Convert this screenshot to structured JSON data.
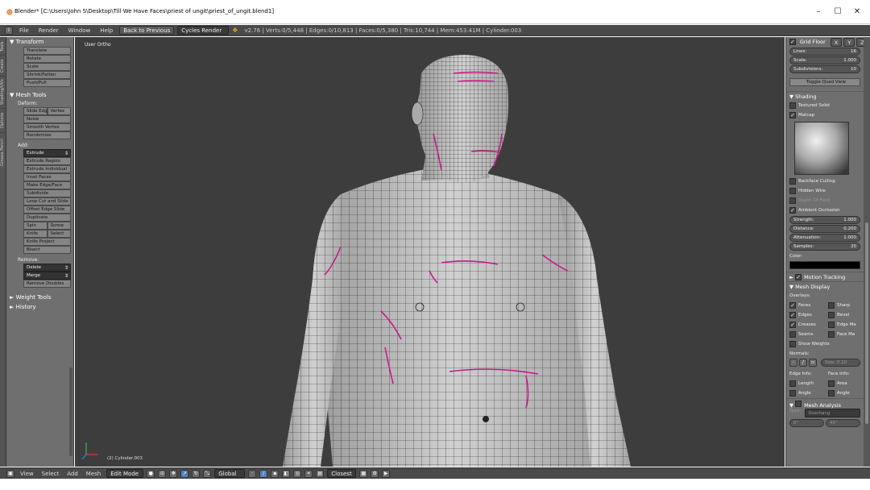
{
  "window": {
    "title": "Blender* [C:\\Users\\John S\\Desktop\\Till We Have Faces\\priest of ungit\\priest_of_ungit.blend1]",
    "minimize": "–",
    "maximize": "☐",
    "close": "✕"
  },
  "topbar": {
    "menus": [
      "File",
      "Render",
      "Window",
      "Help"
    ],
    "back_button": "Back to Previous",
    "render_engine": "Cycles Render",
    "stats": "v2.76 | Verts:0/5,448 | Edges:0/10,813 | Faces:0/5,380 | Tris:10,744 | Mem:453.41M | Cylinder.003"
  },
  "tabs": [
    "Tools",
    "Create",
    "Shading/UVs",
    "Options",
    "Grease Pencil"
  ],
  "toolshelf": {
    "transform_header": "Transform",
    "transform": [
      "Translate",
      "Rotate",
      "Scale",
      "Shrink/Fatten",
      "Push/Pull"
    ],
    "meshtools_header": "Mesh Tools",
    "deform_label": "Deform:",
    "deform_pair": [
      "Slide Edge",
      "Vertex"
    ],
    "deform": [
      "Noise",
      "Smooth Vertex",
      "Randomize"
    ],
    "add_label": "Add:",
    "extrude": "Extrude",
    "add": [
      "Extrude Region",
      "Extrude Individual",
      "Inset Faces",
      "Make Edge/Face",
      "Subdivide",
      "Loop Cut and Slide",
      "Offset Edge Slide",
      "Duplicate"
    ],
    "spin_pair": [
      "Spin",
      "Screw"
    ],
    "knife_pair": [
      "Knife",
      "Select"
    ],
    "add2": [
      "Knife Project",
      "Bisect"
    ],
    "remove_label": "Remove:",
    "delete": "Delete",
    "merge": "Merge",
    "remove_doubles": "Remove Doubles",
    "weight_tools": "Weight Tools",
    "history": "History"
  },
  "viewport": {
    "label": "User Ortho",
    "object_label": "(2) Cylinder.003"
  },
  "props": {
    "grid_floor": "Grid Floor",
    "axes": [
      "X",
      "Y",
      "Z"
    ],
    "lines": {
      "label": "Lines:",
      "value": "16"
    },
    "scale": {
      "label": "Scale:",
      "value": "1.000"
    },
    "subdivisions": {
      "label": "Subdivisions:",
      "value": "10"
    },
    "toggle_quad": "Toggle Quad View",
    "shading_header": "Shading",
    "textured_solid": "Textured Solid",
    "matcap": "Matcap",
    "backface_culling": "Backface Culling",
    "hidden_wire": "Hidden Wire",
    "depth_of_field": "Depth Of Field",
    "ambient_occlusion": "Ambient Occlusion",
    "strength": {
      "label": "Strength:",
      "value": "1.000"
    },
    "distance": {
      "label": "Distance:",
      "value": "0.200"
    },
    "attenuation": {
      "label": "Attenuation:",
      "value": "1.000"
    },
    "samples": {
      "label": "Samples:",
      "value": "20"
    },
    "color_label": "Color:",
    "motion_tracking": "Motion Tracking",
    "mesh_display": "Mesh Display",
    "overlays_label": "Overlays:",
    "overlays": [
      [
        "Faces",
        "Sharp"
      ],
      [
        "Edges",
        "Bevel"
      ],
      [
        "Creases",
        "Edge Ma"
      ],
      [
        "Seams",
        "Face Ma"
      ]
    ],
    "show_weights": "Show Weights",
    "normals_label": "Normals:",
    "size": "Size:  0.10",
    "edge_info": "Edge Info:",
    "face_info": "Face Info:",
    "length": "Length",
    "area": "Area",
    "angle1": "Angle",
    "angle2": "Angle",
    "mesh_analysis": "Mesh Analysis",
    "type_label": "Type:",
    "type_value": "Overhang",
    "range": [
      "0°",
      "45°"
    ]
  },
  "bottombar": {
    "menus": [
      "View",
      "Select",
      "Add",
      "Mesh"
    ],
    "mode": "Edit Mode",
    "orientation": "Global",
    "snap": "Closest"
  },
  "colors": {
    "crease": "#c8198c",
    "viewport_bg": "#3d3d3d",
    "panel": "#6f6f6f"
  }
}
